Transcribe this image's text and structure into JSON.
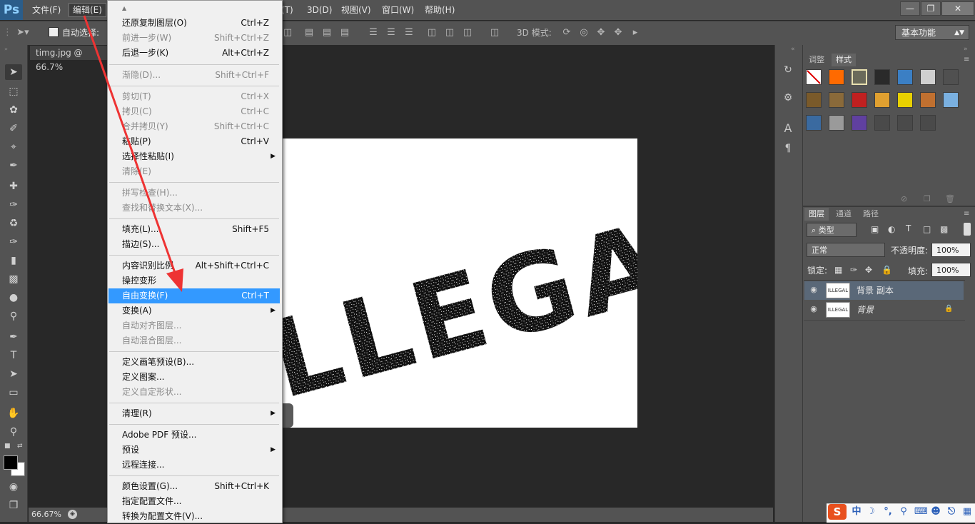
{
  "app": {
    "logo": "Ps",
    "menus": [
      "文件(F)",
      "编辑(E)",
      "3D(D)",
      "视图(V)",
      "窗口(W)",
      "帮助(H)"
    ],
    "partial_menu": "(T)",
    "window_controls": [
      "minimize-icon",
      "restore-icon",
      "close-icon"
    ]
  },
  "options_bar": {
    "auto_select_label": "自动选择:",
    "mode_3d_label": "3D 模式:",
    "workspace": "基本功能"
  },
  "document": {
    "tab_title": "timg.jpg @ 66.7%",
    "zoom_status": "66.67%",
    "image_text": "LLEGAL"
  },
  "edit_menu": {
    "items": [
      {
        "label": "还原复制图层(O)",
        "shortcut": "Ctrl+Z",
        "enabled": true
      },
      {
        "label": "前进一步(W)",
        "shortcut": "Shift+Ctrl+Z",
        "enabled": false
      },
      {
        "label": "后退一步(K)",
        "shortcut": "Alt+Ctrl+Z",
        "enabled": true
      },
      {
        "label": "渐隐(D)...",
        "shortcut": "Shift+Ctrl+F",
        "enabled": false
      },
      {
        "label": "剪切(T)",
        "shortcut": "Ctrl+X",
        "enabled": false
      },
      {
        "label": "拷贝(C)",
        "shortcut": "Ctrl+C",
        "enabled": false
      },
      {
        "label": "合并拷贝(Y)",
        "shortcut": "Shift+Ctrl+C",
        "enabled": false
      },
      {
        "label": "粘贴(P)",
        "shortcut": "Ctrl+V",
        "enabled": true
      },
      {
        "label": "选择性粘贴(I)",
        "shortcut": "",
        "enabled": true,
        "submenu": true
      },
      {
        "label": "清除(E)",
        "shortcut": "",
        "enabled": false
      },
      {
        "label": "拼写检查(H)...",
        "shortcut": "",
        "enabled": false
      },
      {
        "label": "查找和替换文本(X)...",
        "shortcut": "",
        "enabled": false
      },
      {
        "label": "填充(L)...",
        "shortcut": "Shift+F5",
        "enabled": true
      },
      {
        "label": "描边(S)...",
        "shortcut": "",
        "enabled": true
      },
      {
        "label": "内容识别比例",
        "shortcut": "Alt+Shift+Ctrl+C",
        "enabled": true
      },
      {
        "label": "操控变形",
        "shortcut": "",
        "enabled": true
      },
      {
        "label": "自由变换(F)",
        "shortcut": "Ctrl+T",
        "enabled": true,
        "highlighted": true
      },
      {
        "label": "变换(A)",
        "shortcut": "",
        "enabled": true,
        "submenu": true
      },
      {
        "label": "自动对齐图层...",
        "shortcut": "",
        "enabled": false
      },
      {
        "label": "自动混合图层...",
        "shortcut": "",
        "enabled": false
      },
      {
        "label": "定义画笔预设(B)...",
        "shortcut": "",
        "enabled": true
      },
      {
        "label": "定义图案...",
        "shortcut": "",
        "enabled": true
      },
      {
        "label": "定义自定形状...",
        "shortcut": "",
        "enabled": false
      },
      {
        "label": "清理(R)",
        "shortcut": "",
        "enabled": true,
        "submenu": true
      },
      {
        "label": "Adobe PDF 预设...",
        "shortcut": "",
        "enabled": true
      },
      {
        "label": "预设",
        "shortcut": "",
        "enabled": true,
        "submenu": true
      },
      {
        "label": "远程连接...",
        "shortcut": "",
        "enabled": true
      },
      {
        "label": "颜色设置(G)...",
        "shortcut": "Shift+Ctrl+K",
        "enabled": true
      },
      {
        "label": "指定配置文件...",
        "shortcut": "",
        "enabled": true
      },
      {
        "label": "转换为配置文件(V)...",
        "shortcut": "",
        "enabled": true
      }
    ]
  },
  "styles_panel": {
    "tabs": [
      "调整",
      "样式"
    ],
    "swatch_colors": [
      "#ffffff",
      "#ff6a00",
      "#e8e0b0",
      "#2a2a2a",
      "#3b7fc4",
      "#d0d0d0",
      "#505050",
      "#7a5a2a",
      "#8a6a3a",
      "#c02020",
      "#e0a030",
      "#e8d000",
      "#c07030",
      "#7ab0e0",
      "#3a6aa0",
      "#9a9a9a",
      "#6040a0",
      "#4a4a4a",
      "#4a4a4a",
      "#4a4a4a"
    ]
  },
  "layers_panel": {
    "tabs": [
      "图层",
      "通道",
      "路径"
    ],
    "filter_label": "类型",
    "blend_mode": "正常",
    "opacity_label": "不透明度:",
    "opacity_value": "100%",
    "lock_label": "锁定:",
    "fill_label": "填充:",
    "fill_value": "100%",
    "layers": [
      {
        "name": "背景 副本",
        "thumb": "ILLEGAL",
        "selected": true
      },
      {
        "name": "背景",
        "thumb": "ILLEGAL",
        "selected": false
      }
    ]
  },
  "ime": {
    "label": "中"
  },
  "colors": {
    "highlight": "#3399ff",
    "arrow": "#ee3333",
    "ui_bg": "#535353"
  }
}
